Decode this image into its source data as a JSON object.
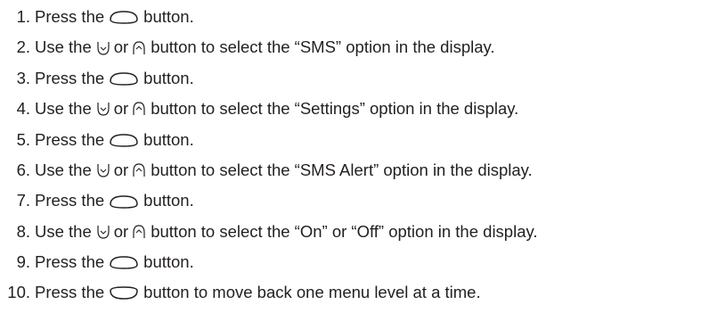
{
  "steps": [
    {
      "number": "1.",
      "before": "Press the",
      "icon": "select-button-icon",
      "after": "button."
    },
    {
      "number": "2.",
      "before": "Use the",
      "icon_down": "down-arrow-button-icon",
      "mid": "or",
      "icon_up": "up-arrow-button-icon",
      "after": "button to select the “SMS” option in the display."
    },
    {
      "number": "3.",
      "before": "Press the",
      "icon": "select-button-icon",
      "after": "button."
    },
    {
      "number": "4.",
      "before": "Use the",
      "icon_down": "down-arrow-button-icon",
      "mid": "or",
      "icon_up": "up-arrow-button-icon",
      "after": "button to select the “Settings” option in the display."
    },
    {
      "number": "5.",
      "before": "Press the",
      "icon": "select-button-icon",
      "after": "button."
    },
    {
      "number": "6.",
      "before": "Use the",
      "icon_down": "down-arrow-button-icon",
      "mid": "or",
      "icon_up": "up-arrow-button-icon",
      "after": "button to select the “SMS Alert” option in the display."
    },
    {
      "number": "7.",
      "before": "Press the",
      "icon": "select-button-icon",
      "after": "button."
    },
    {
      "number": "8.",
      "before": "Use the",
      "icon_down": "down-arrow-button-icon",
      "mid": "or",
      "icon_up": "up-arrow-button-icon",
      "after": "button to select the “On” or “Off” option in the display."
    },
    {
      "number": "9.",
      "before": "Press the",
      "icon": "select-button-icon",
      "after": "button."
    },
    {
      "number": "10.",
      "before": "Press the",
      "icon": "back-button-icon",
      "after": "button to move back one menu level at a time."
    }
  ]
}
